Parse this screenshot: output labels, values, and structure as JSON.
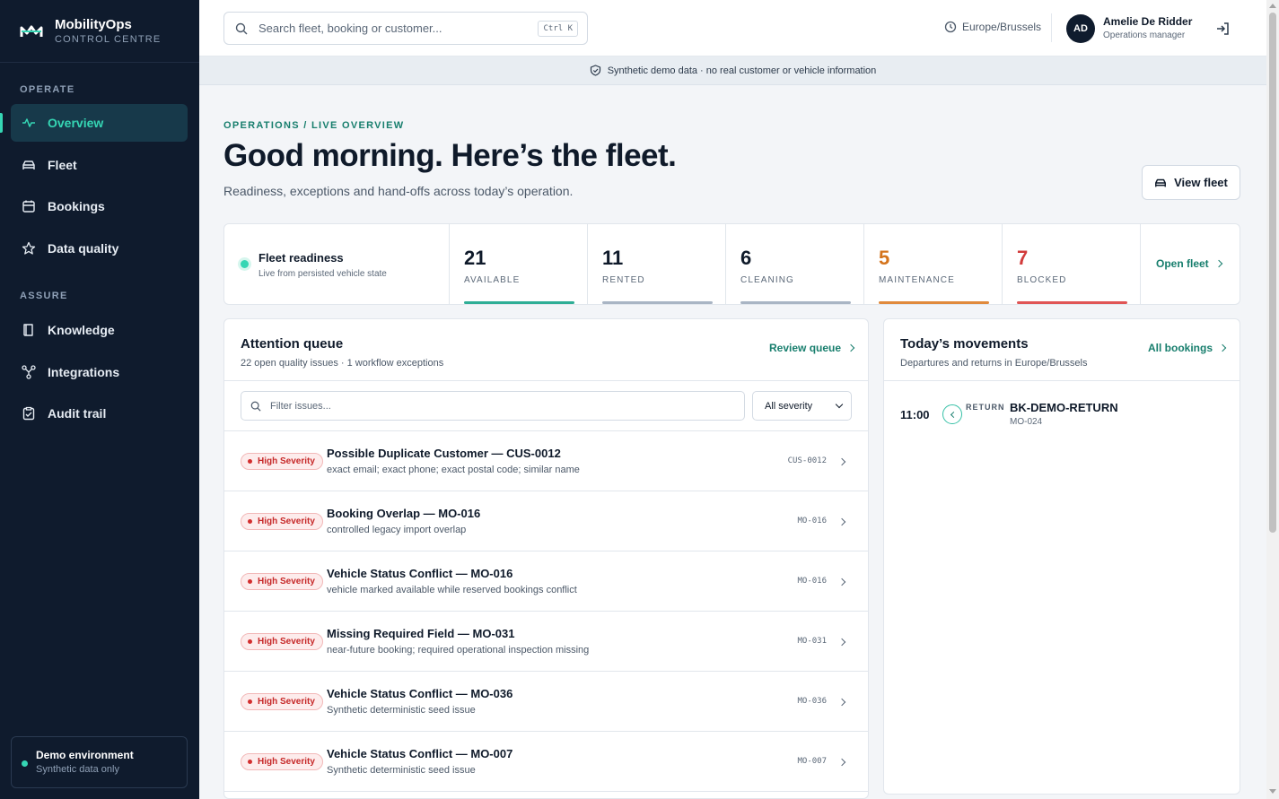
{
  "brand": {
    "name": "MobilityOps",
    "subtitle": "CONTROL CENTRE"
  },
  "sidebar": {
    "sections": [
      {
        "label": "OPERATE"
      },
      {
        "label": "ASSURE"
      }
    ],
    "items": [
      {
        "label": "Overview",
        "icon": "pulse-icon",
        "active": true
      },
      {
        "label": "Fleet",
        "icon": "car-icon"
      },
      {
        "label": "Bookings",
        "icon": "calendar-icon"
      },
      {
        "label": "Data quality",
        "icon": "star-icon"
      },
      {
        "label": "Knowledge",
        "icon": "book-icon"
      },
      {
        "label": "Integrations",
        "icon": "nodes-icon"
      },
      {
        "label": "Audit trail",
        "icon": "clipboard-check-icon"
      }
    ],
    "demo": {
      "title": "Demo environment",
      "subtitle": "Synthetic data only"
    }
  },
  "topbar": {
    "search_placeholder": "Search fleet, booking or customer...",
    "shortcut": "Ctrl K",
    "timezone": "Europe/Brussels",
    "user": {
      "initials": "AD",
      "name": "Amelie De Ridder",
      "role": "Operations manager"
    }
  },
  "banner": {
    "text": "Synthetic demo data · no real customer or vehicle information"
  },
  "header": {
    "eyebrow": "OPERATIONS / LIVE OVERVIEW",
    "title": "Good morning. Here’s the fleet.",
    "subtitle": "Readiness, exceptions and hand-offs across today’s operation.",
    "view_fleet_label": "View fleet"
  },
  "readiness": {
    "title": "Fleet readiness",
    "subtitle": "Live from persisted vehicle state",
    "open_fleet_label": "Open fleet",
    "stats": [
      {
        "value": "21",
        "label": "AVAILABLE",
        "color": "#0f1a2a",
        "bar": "#2fae96"
      },
      {
        "value": "11",
        "label": "RENTED",
        "color": "#0f1a2a",
        "bar": "#a9b5c4"
      },
      {
        "value": "6",
        "label": "CLEANING",
        "color": "#0f1a2a",
        "bar": "#a9b5c4"
      },
      {
        "value": "5",
        "label": "MAINTENANCE",
        "color": "#d4731b",
        "bar": "#e08a3c"
      },
      {
        "value": "7",
        "label": "BLOCKED",
        "color": "#d23b3b",
        "bar": "#e05555"
      }
    ]
  },
  "queue": {
    "title": "Attention queue",
    "subtitle": "22 open quality issues · 1 workflow exceptions",
    "review_label": "Review queue",
    "filter_placeholder": "Filter issues...",
    "severity_selected": "All severity",
    "issues": [
      {
        "badge": "High Severity",
        "title": "Possible Duplicate Customer — CUS-0012",
        "desc": "exact email; exact phone; exact postal code; similar name",
        "code": "CUS-0012"
      },
      {
        "badge": "High Severity",
        "title": "Booking Overlap — MO-016",
        "desc": "controlled legacy import overlap",
        "code": "MO-016"
      },
      {
        "badge": "High Severity",
        "title": "Vehicle Status Conflict — MO-016",
        "desc": "vehicle marked available while reserved bookings conflict",
        "code": "MO-016"
      },
      {
        "badge": "High Severity",
        "title": "Missing Required Field — MO-031",
        "desc": "near-future booking; required operational inspection missing",
        "code": "MO-031"
      },
      {
        "badge": "High Severity",
        "title": "Vehicle Status Conflict — MO-036",
        "desc": "Synthetic deterministic seed issue",
        "code": "MO-036"
      },
      {
        "badge": "High Severity",
        "title": "Vehicle Status Conflict — MO-007",
        "desc": "Synthetic deterministic seed issue",
        "code": "MO-007"
      }
    ]
  },
  "movements": {
    "title": "Today’s movements",
    "subtitle": "Departures and returns in Europe/Brussels",
    "all_label": "All bookings",
    "items": [
      {
        "time": "11:00",
        "type": "RETURN",
        "ref": "BK-DEMO-RETURN",
        "vehicle": "MO-024"
      }
    ]
  }
}
